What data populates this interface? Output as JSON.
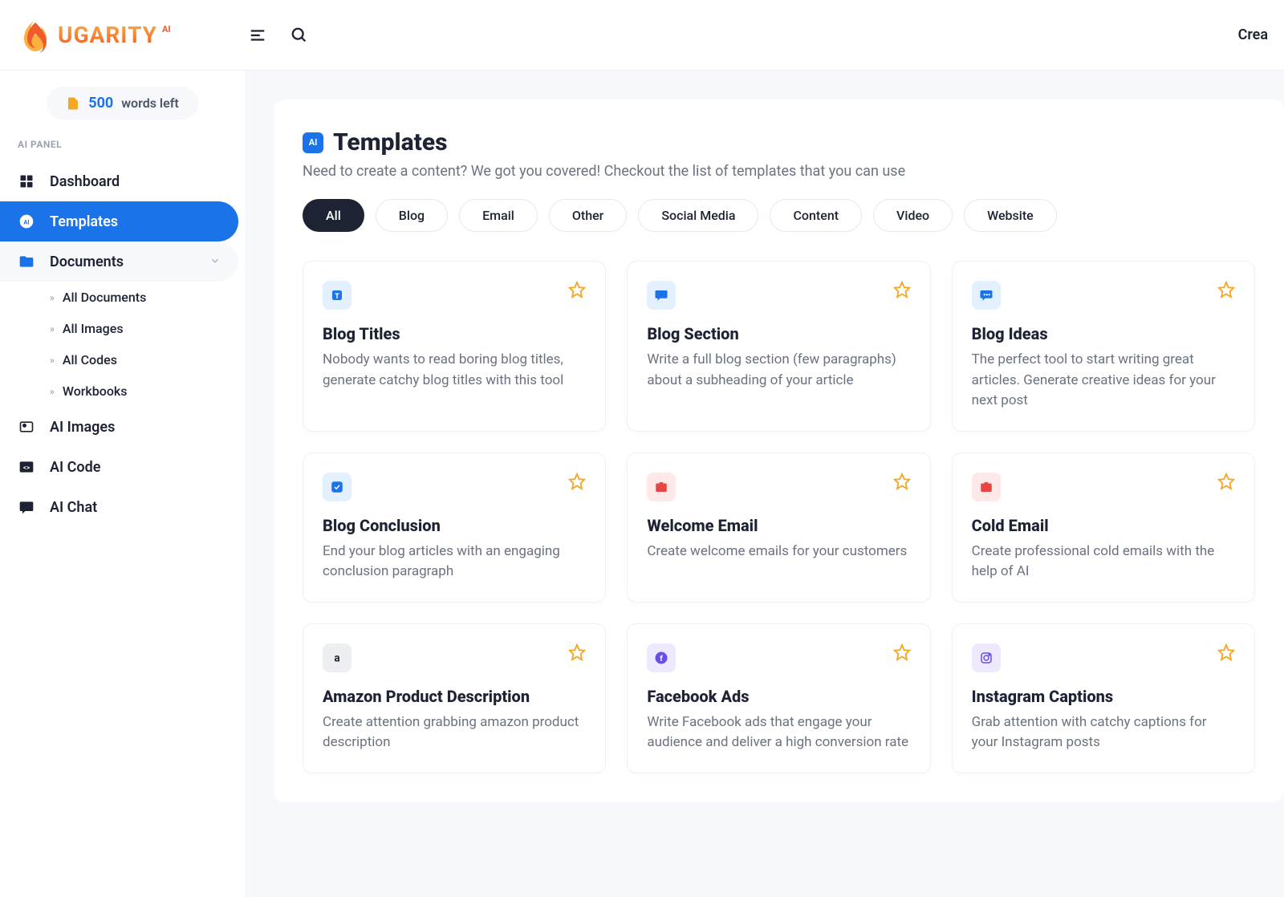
{
  "header": {
    "right_text": "Crea",
    "logo_text": "UGARITY",
    "logo_ai": "AI"
  },
  "sidebar": {
    "words_count": "500",
    "words_label": "words left",
    "panel_label": "AI PANEL",
    "items": [
      {
        "label": "Dashboard"
      },
      {
        "label": "Templates"
      },
      {
        "label": "Documents"
      },
      {
        "label": "AI Images"
      },
      {
        "label": "AI Code"
      },
      {
        "label": "AI Chat"
      }
    ],
    "doc_subitems": [
      {
        "label": "All Documents"
      },
      {
        "label": "All Images"
      },
      {
        "label": "All Codes"
      },
      {
        "label": "Workbooks"
      }
    ]
  },
  "page": {
    "title": "Templates",
    "subtitle": "Need to create a content? We got you covered! Checkout the list of templates that you can use",
    "ai_badge": "AI"
  },
  "filters": [
    "All",
    "Blog",
    "Email",
    "Other",
    "Social Media",
    "Content",
    "Video",
    "Website"
  ],
  "templates": [
    {
      "title": "Blog Titles",
      "desc": "Nobody wants to read boring blog titles, generate catchy blog titles with this tool",
      "color": "blue",
      "icon": "T"
    },
    {
      "title": "Blog Section",
      "desc": "Write a full blog section (few paragraphs) about a subheading of your article",
      "color": "blue",
      "icon": "msg"
    },
    {
      "title": "Blog Ideas",
      "desc": "The perfect tool to start writing great articles. Generate creative ideas for your next post",
      "color": "blue",
      "icon": "chat"
    },
    {
      "title": "Blog Conclusion",
      "desc": "End your blog articles with an engaging conclusion paragraph",
      "color": "blue",
      "icon": "check"
    },
    {
      "title": "Welcome Email",
      "desc": "Create welcome emails for your customers",
      "color": "red",
      "icon": "brief"
    },
    {
      "title": "Cold Email",
      "desc": "Create professional cold emails with the help of AI",
      "color": "red",
      "icon": "brief"
    },
    {
      "title": "Amazon Product Description",
      "desc": "Create attention grabbing amazon product description",
      "color": "dark",
      "icon": "a"
    },
    {
      "title": "Facebook Ads",
      "desc": "Write Facebook ads that engage your audience and deliver a high conversion rate",
      "color": "purple",
      "icon": "fb"
    },
    {
      "title": "Instagram Captions",
      "desc": "Grab attention with catchy captions for your Instagram posts",
      "color": "purple",
      "icon": "ig"
    }
  ]
}
